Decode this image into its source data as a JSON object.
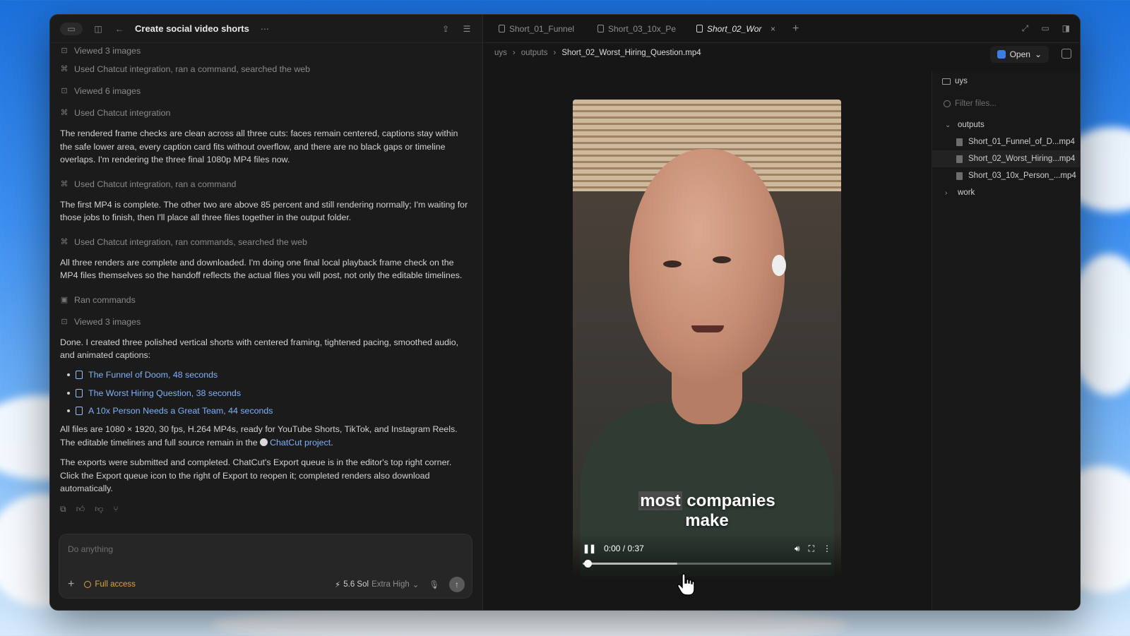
{
  "thread": {
    "title": "Create social video shorts",
    "activities": {
      "a1": "Viewed 3 images",
      "a2": "Used Chatcut integration, ran a command, searched the web",
      "a3": "Viewed 6 images",
      "a4": "Used Chatcut integration",
      "a5": "Used Chatcut integration, ran a command",
      "a6": "Used Chatcut integration, ran commands, searched the web",
      "a7": "Ran commands",
      "a8": "Viewed 3 images"
    },
    "messages": {
      "m1": "The rendered frame checks are clean across all three cuts: faces remain centered, captions stay within the safe lower area, every caption card fits without overflow, and there are no black gaps or timeline overlaps. I'm rendering the three final 1080p MP4 files now.",
      "m2": "The first MP4 is complete. The other two are above 85 percent and still rendering normally; I'm waiting for those jobs to finish, then I'll place all three files together in the output folder.",
      "m3": "All three renders are complete and downloaded. I'm doing one final local playback frame check on the MP4 files themselves so the handoff reflects the actual files you will post, not only the editable timelines.",
      "m4": "Done. I created three polished vertical shorts with centered framing, tightened pacing, smoothed audio, and animated captions:",
      "m5_part1": "All files are 1080 × 1920, 30 fps, H.264 MP4s, ready for YouTube Shorts, TikTok, and Instagram Reels. The editable timelines and full source remain in the",
      "m5_link": "ChatCut project",
      "m5_end": ".",
      "m6": "The exports were submitted and completed. ChatCut's Export queue is in the editor's top right corner. Click the Export queue icon to the right of Export to reopen it; completed renders also download automatically."
    },
    "file_links": [
      "The Funnel of Doom, 48 seconds",
      "The Worst Hiring Question, 38 seconds",
      "A 10x Person Needs a Great Team, 44 seconds"
    ]
  },
  "composer": {
    "placeholder": "Do anything",
    "access": "Full access",
    "model": "5.6 Sol",
    "effort": "Extra High"
  },
  "tabs": [
    {
      "label": "Short_01_Funnel"
    },
    {
      "label": "Short_03_10x_Pe"
    },
    {
      "label": "Short_02_Wor"
    }
  ],
  "breadcrumb": {
    "root": "uys",
    "folder": "outputs",
    "file": "Short_02_Worst_Hiring_Question.mp4"
  },
  "open_button": "Open",
  "video": {
    "caption_highlight": "most",
    "caption_rest": "companies",
    "caption_line2": "make",
    "time": "0:00 / 0:37",
    "played_fraction": 0.02,
    "buffered_fraction": 0.38
  },
  "files_panel": {
    "root": "uys",
    "filter_placeholder": "Filter files...",
    "folder_outputs": "outputs",
    "files": [
      "Short_01_Funnel_of_D...mp4",
      "Short_02_Worst_Hiring...mp4",
      "Short_03_10x_Person_...mp4"
    ],
    "folder_work": "work"
  },
  "colors": {
    "link": "#7fb1f5",
    "access": "#e0a23e",
    "open_icon": "#3d7fe0"
  }
}
